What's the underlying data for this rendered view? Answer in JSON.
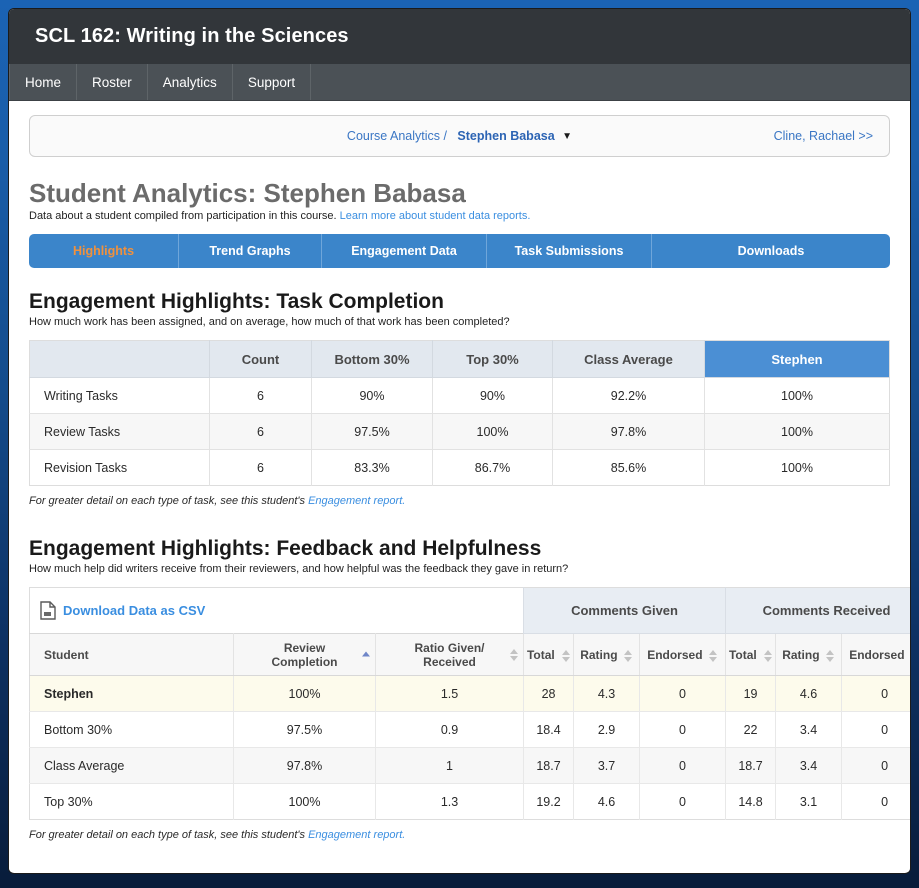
{
  "course": {
    "title": "SCL 162: Writing in the Sciences"
  },
  "nav": {
    "items": [
      "Home",
      "Roster",
      "Analytics",
      "Support"
    ]
  },
  "breadcrumb": {
    "parent": "Course Analytics /",
    "current": "Stephen Babasa",
    "caret": "▼",
    "next": "Cline, Rachael >>"
  },
  "page": {
    "title": "Student Analytics: Stephen Babasa",
    "subtitle": "Data about a student compiled from participation in this course.",
    "subtitle_link": "Learn more about student data reports."
  },
  "tabs": [
    {
      "label": "Highlights",
      "active": true
    },
    {
      "label": "Trend Graphs",
      "active": false
    },
    {
      "label": "Engagement Data",
      "active": false
    },
    {
      "label": "Task Submissions",
      "active": false
    },
    {
      "label": "Downloads",
      "active": false
    }
  ],
  "task_completion": {
    "title": "Engagement Highlights: Task Completion",
    "subtitle": "How much work has been assigned, and on average, how much of that work has been completed?",
    "columns": [
      "",
      "Count",
      "Bottom 30%",
      "Top 30%",
      "Class Average",
      "Stephen"
    ],
    "rows": [
      {
        "label": "Writing Tasks",
        "count": "6",
        "bottom30": "90%",
        "top30": "90%",
        "class_avg": "92.2%",
        "student": "100%"
      },
      {
        "label": "Review Tasks",
        "count": "6",
        "bottom30": "97.5%",
        "top30": "100%",
        "class_avg": "97.8%",
        "student": "100%"
      },
      {
        "label": "Revision Tasks",
        "count": "6",
        "bottom30": "83.3%",
        "top30": "86.7%",
        "class_avg": "85.6%",
        "student": "100%"
      }
    ],
    "note_text": "For greater detail on each type of task, see this student's ",
    "note_link": "Engagement report."
  },
  "feedback": {
    "title": "Engagement Highlights: Feedback and Helpfulness",
    "subtitle": "How much help did writers receive from their reviewers, and how helpful was the feedback they gave in return?",
    "download_label": "Download Data as CSV",
    "group_headers": [
      "Comments Given",
      "Comments Received"
    ],
    "columns": [
      "Student",
      "Review Completion",
      "Ratio Given/ Received",
      "Total",
      "Rating",
      "Endorsed",
      "Total",
      "Rating",
      "Endorsed"
    ],
    "col_review_completion_line1": "Review",
    "col_review_completion_line2": "Completion",
    "col_ratio_line1": "Ratio Given/",
    "col_ratio_line2": "Received",
    "col_student": "Student",
    "col_total_given": "Total",
    "col_rating_given": "Rating",
    "col_endorsed_given": "Endorsed",
    "col_total_received": "Total",
    "col_rating_received": "Rating",
    "col_endorsed_received": "Endorsed",
    "sorted_by": "Review Completion",
    "sort_direction": "asc",
    "rows": [
      {
        "student": "Stephen",
        "review_completion": "100%",
        "ratio": "1.5",
        "given_total": "28",
        "given_rating": "4.3",
        "given_endorsed": "0",
        "recv_total": "19",
        "recv_rating": "4.6",
        "recv_endorsed": "0"
      },
      {
        "student": "Bottom 30%",
        "review_completion": "97.5%",
        "ratio": "0.9",
        "given_total": "18.4",
        "given_rating": "2.9",
        "given_endorsed": "0",
        "recv_total": "22",
        "recv_rating": "3.4",
        "recv_endorsed": "0"
      },
      {
        "student": "Class Average",
        "review_completion": "97.8%",
        "ratio": "1",
        "given_total": "18.7",
        "given_rating": "3.7",
        "given_endorsed": "0",
        "recv_total": "18.7",
        "recv_rating": "3.4",
        "recv_endorsed": "0"
      },
      {
        "student": "Top 30%",
        "review_completion": "100%",
        "ratio": "1.3",
        "given_total": "19.2",
        "given_rating": "4.6",
        "given_endorsed": "0",
        "recv_total": "14.8",
        "recv_rating": "3.1",
        "recv_endorsed": "0"
      }
    ],
    "note_text": "For greater detail on each type of task, see this student's ",
    "note_link": "Engagement report."
  },
  "colors": {
    "accent_blue": "#3b85ca",
    "active_tab_text": "#f0913d",
    "link_blue": "#3a8ee0",
    "header_dark": "#32363a",
    "highlight_row": "#fdfbec",
    "stephen_col": "#4b8fd4"
  }
}
